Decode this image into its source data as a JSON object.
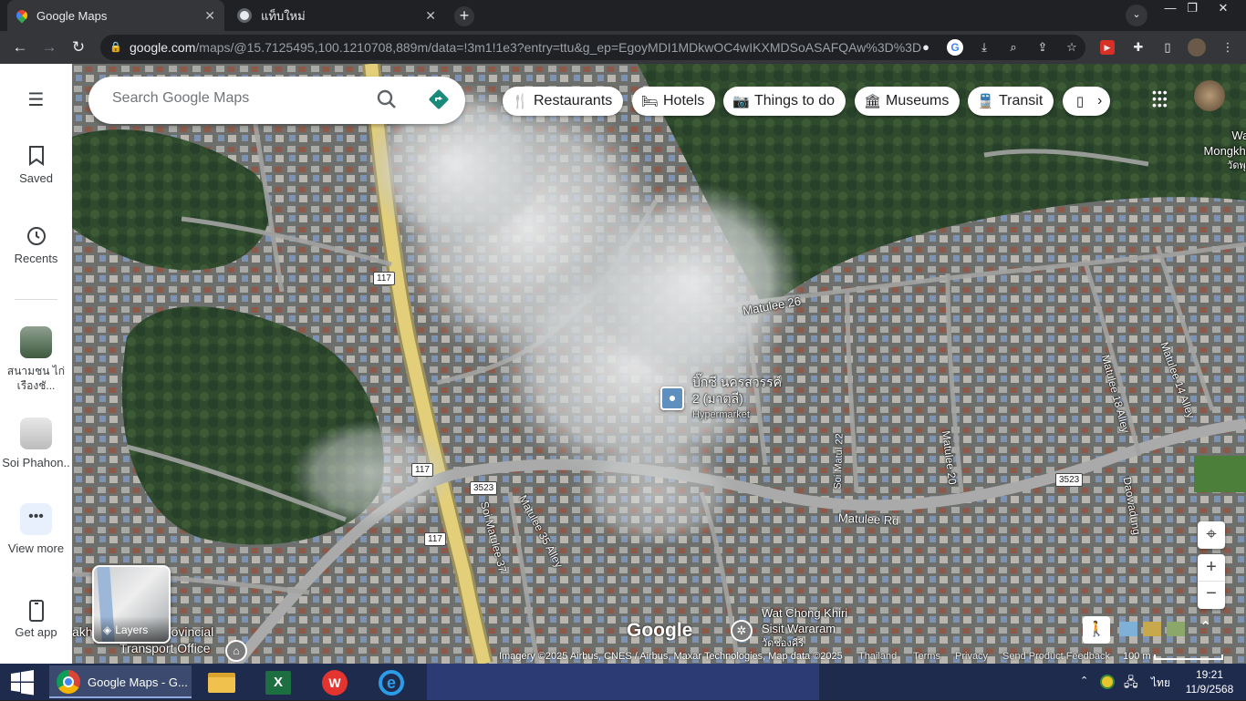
{
  "browser": {
    "tabs": [
      {
        "title": "Google Maps",
        "active": true
      },
      {
        "title": "แท็บใหม่",
        "active": false
      }
    ],
    "url_host": "google.com",
    "url_rest": "/maps/@15.7125495,100.1210708,889m/data=!3m1!1e3?entry=ttu&g_ep=EgoyMDI1MDkwOC4wIKXMDSoASAFQAw%3D%3D",
    "window_controls": {
      "minimize": "—",
      "restore": "❐",
      "close": "✕"
    }
  },
  "sidebar": {
    "menu_icon": "hamburger-icon",
    "items": [
      {
        "label": "Saved",
        "icon": "bookmark-icon"
      },
      {
        "label": "Recents",
        "icon": "history-icon"
      },
      {
        "label": "สนามชน ไก่เรืองชั...",
        "icon": "place-thumbnail"
      },
      {
        "label": "Soi Phahon..",
        "icon": "place-thumbnail"
      },
      {
        "label": "View more",
        "icon": "more-icon"
      },
      {
        "label": "Get app",
        "icon": "phone-icon"
      }
    ]
  },
  "search": {
    "placeholder": "Search Google Maps"
  },
  "chips": [
    {
      "label": "Restaurants",
      "icon": "fork-knife-icon"
    },
    {
      "label": "Hotels",
      "icon": "bed-icon"
    },
    {
      "label": "Things to do",
      "icon": "camera-icon"
    },
    {
      "label": "Museums",
      "icon": "museum-icon"
    },
    {
      "label": "Transit",
      "icon": "train-icon"
    }
  ],
  "map_labels": {
    "place_name_1": "บิ๊กซี นครสวรรค์",
    "place_name_2": "2 (มาตุลี)",
    "place_type": "Hypermarket",
    "road_matulee_26": "Matulee 26",
    "road_matulee_rd": "Matulee Rd",
    "road_soi_matul_22": "Soi Matul 22",
    "road_matulee_20": "Matulee 20",
    "road_matulee_18": "Matulee 18 Alley",
    "road_matulee_14": "Matulee 14 Alley",
    "road_matulee_35": "Matulee 35 Alley",
    "road_soi_matulee_37": "Soi Matulee 37",
    "road_daowadung": "Daowadung",
    "wat_top_1": "Wat",
    "wat_top_2": "Mongkho",
    "wat_top_3": "วัดพุท",
    "wat_chong_1": "Wat Chong Khiri",
    "wat_chong_2": "Sisit Wararam",
    "wat_chong_3": "วัดช่องคีรี",
    "transport_1": "akh",
    "transport_2": "ovincial",
    "transport_3": "Transport Office",
    "shield_117": "117",
    "shield_3523": "3523",
    "google_logo": "Google"
  },
  "layers_label": "Layers",
  "attribution": {
    "imagery": "Imagery ©2025 Airbus, CNES / Airbus, Maxar Technologies, Map data ©2025",
    "country": "Thailand",
    "terms": "Terms",
    "privacy": "Privacy",
    "feedback": "Send Product Feedback",
    "scale": "100 m"
  },
  "taskbar": {
    "chrome_title": "Google Maps - G...",
    "lang": "ไทย",
    "time": "19:21",
    "date": "11/9/2568"
  }
}
